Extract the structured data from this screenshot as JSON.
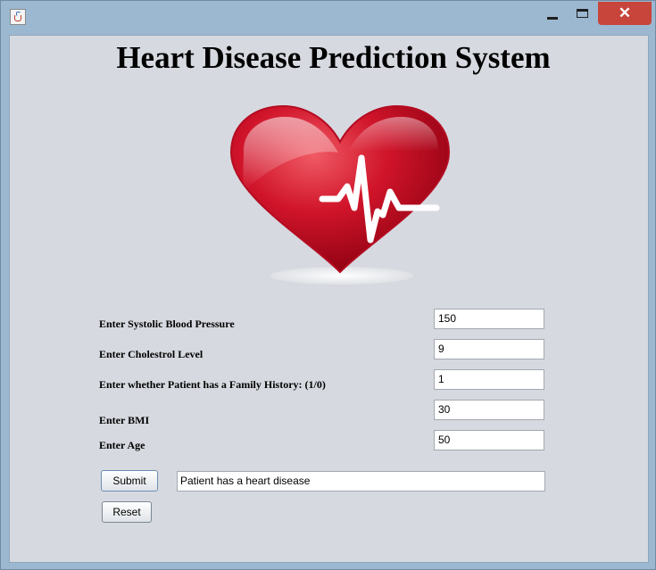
{
  "window": {
    "icons": {
      "app": "java-cup-icon",
      "minimize": "minimize-icon",
      "maximize": "maximize-icon",
      "close": "close-icon"
    },
    "close_glyph": "✕"
  },
  "app": {
    "title": "Heart Disease Prediction System",
    "logo": "heart-ecg-icon"
  },
  "form": {
    "systolic": {
      "label": "Enter Systolic Blood Pressure",
      "value": "150"
    },
    "cholesterol": {
      "label": "Enter Cholestrol Level",
      "value": "9"
    },
    "family_history": {
      "label": "Enter whether Patient has a Family History: (1/0)",
      "value": "1"
    },
    "bmi": {
      "label": "Enter BMI",
      "value": "30"
    },
    "age": {
      "label": "Enter Age",
      "value": "50"
    }
  },
  "actions": {
    "submit_label": "Submit",
    "reset_label": "Reset"
  },
  "result": {
    "text": "Patient has a heart disease"
  },
  "colors": {
    "background": "#d6d9df",
    "titlebar": "#9bb8d0",
    "close": "#c7453b",
    "heart": "#c8102e"
  }
}
